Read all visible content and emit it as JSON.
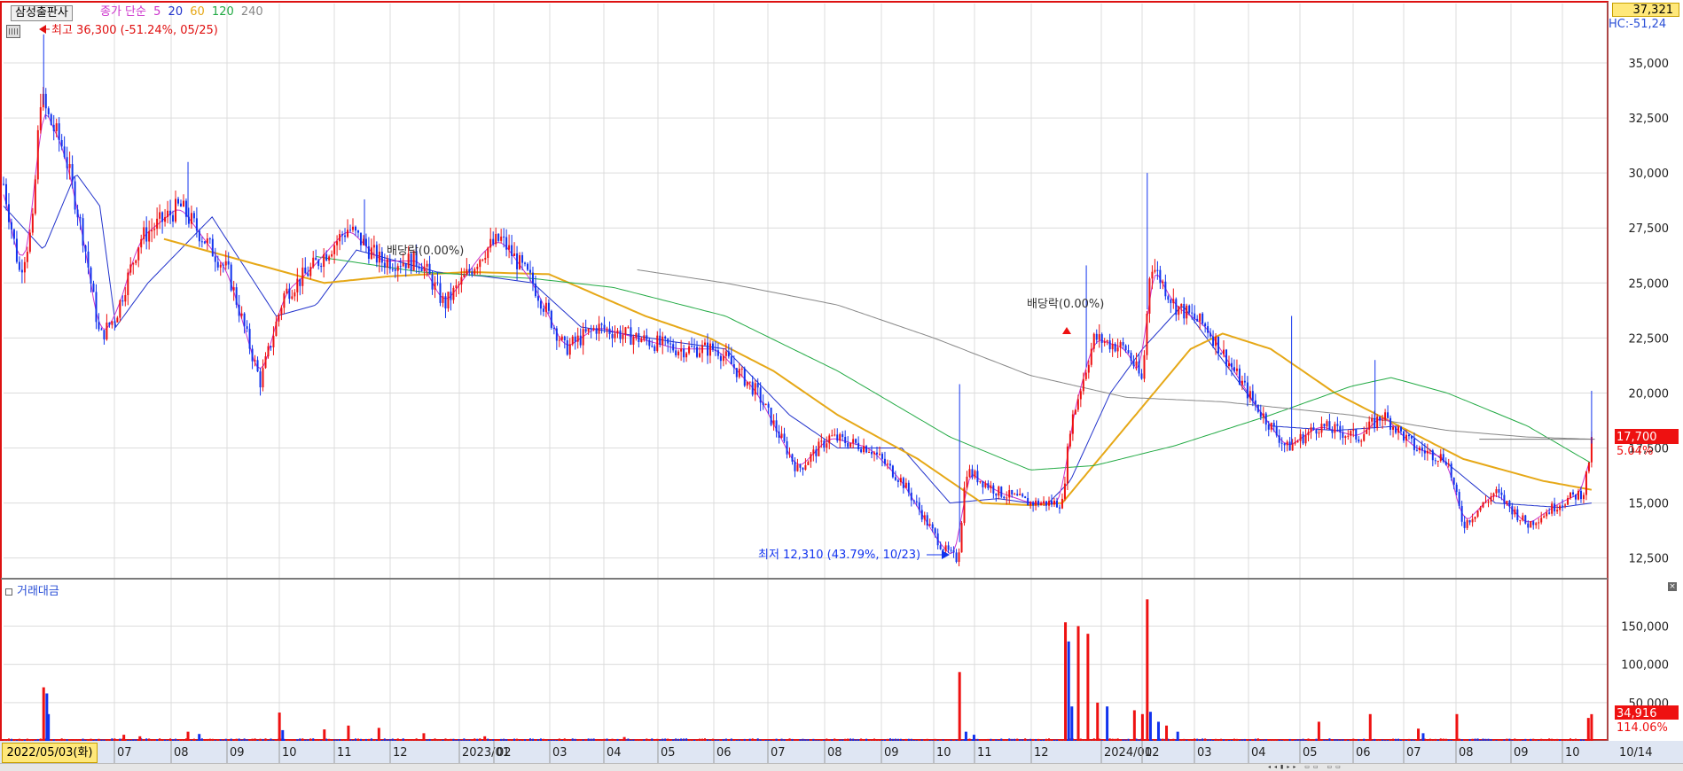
{
  "header": {
    "stock_name": "삼성출판사",
    "ma_prefix": "종가 단순",
    "ma_periods": [
      {
        "label": "5",
        "color": "#cc33cc"
      },
      {
        "label": "20",
        "color": "#2233cc"
      },
      {
        "label": "60",
        "color": "#e6a817"
      },
      {
        "label": "120",
        "color": "#22aa44"
      },
      {
        "label": "240",
        "color": "#888888"
      }
    ],
    "current_box": "37,321",
    "hc_label": "HC:-51,24"
  },
  "annotations": {
    "high": "최고 36,300 (-51.24%, 05/25)",
    "low": "최저 12,310 (43.79%, 10/23)",
    "dividend1": "배당락(0.00%)",
    "dividend2": "배당락(0.00%)"
  },
  "price_labels": {
    "last_price": "17,700",
    "last_change": "5.04%",
    "last_volume": "34,916",
    "volume_pct": "114.06%"
  },
  "volume_panel": {
    "title": "거래대금",
    "close": "×"
  },
  "x_axis": {
    "start_date": "2022/05/03(화)",
    "end_label": "10/14",
    "ticks": [
      "07",
      "08",
      "09",
      "10",
      "11",
      "12",
      "2023/01",
      "02",
      "03",
      "04",
      "05",
      "06",
      "07",
      "08",
      "09",
      "10",
      "11",
      "12",
      "2024/01",
      "02",
      "03",
      "04",
      "05",
      "06",
      "07",
      "08",
      "09",
      "10"
    ]
  },
  "colors": {
    "up": "#ee1111",
    "down": "#1133ee",
    "frame": "#d11",
    "grid": "#dcdcdc"
  },
  "chart_data": {
    "type": "candlestick",
    "y_axis": {
      "ticks": [
        "35,000",
        "32,500",
        "30,000",
        "27,500",
        "25,000",
        "22,500",
        "20,000",
        "17,500",
        "15,000",
        "12,500"
      ],
      "ylim": [
        11600,
        37700
      ]
    },
    "volume_axis": {
      "ticks": [
        "150,000",
        "100,000",
        "50,000"
      ],
      "ylim": [
        0,
        190000
      ]
    },
    "price_anchors": [
      {
        "t": 0.0,
        "v": 29500
      },
      {
        "t": 0.01,
        "v": 25500
      },
      {
        "t": 0.018,
        "v": 27500
      },
      {
        "t": 0.023,
        "v": 33500
      },
      {
        "t": 0.028,
        "v": 32500
      },
      {
        "t": 0.038,
        "v": 31000
      },
      {
        "t": 0.05,
        "v": 27000
      },
      {
        "t": 0.06,
        "v": 22500
      },
      {
        "t": 0.07,
        "v": 23500
      },
      {
        "t": 0.085,
        "v": 27000
      },
      {
        "t": 0.11,
        "v": 28500
      },
      {
        "t": 0.125,
        "v": 27000
      },
      {
        "t": 0.14,
        "v": 25500
      },
      {
        "t": 0.16,
        "v": 20500
      },
      {
        "t": 0.175,
        "v": 24500
      },
      {
        "t": 0.19,
        "v": 25500
      },
      {
        "t": 0.215,
        "v": 27500
      },
      {
        "t": 0.235,
        "v": 26000
      },
      {
        "t": 0.26,
        "v": 26000
      },
      {
        "t": 0.275,
        "v": 24000
      },
      {
        "t": 0.3,
        "v": 26500
      },
      {
        "t": 0.31,
        "v": 27000
      },
      {
        "t": 0.33,
        "v": 25000
      },
      {
        "t": 0.35,
        "v": 22000
      },
      {
        "t": 0.37,
        "v": 23000
      },
      {
        "t": 0.395,
        "v": 22500
      },
      {
        "t": 0.42,
        "v": 22000
      },
      {
        "t": 0.445,
        "v": 22000
      },
      {
        "t": 0.47,
        "v": 20000
      },
      {
        "t": 0.495,
        "v": 16500
      },
      {
        "t": 0.515,
        "v": 18000
      },
      {
        "t": 0.54,
        "v": 17500
      },
      {
        "t": 0.56,
        "v": 16000
      },
      {
        "t": 0.585,
        "v": 13000
      },
      {
        "t": 0.595,
        "v": 12400
      },
      {
        "t": 0.6,
        "v": 16500
      },
      {
        "t": 0.62,
        "v": 15500
      },
      {
        "t": 0.64,
        "v": 15000
      },
      {
        "t": 0.66,
        "v": 15000
      },
      {
        "t": 0.665,
        "v": 18500
      },
      {
        "t": 0.68,
        "v": 22500
      },
      {
        "t": 0.7,
        "v": 22000
      },
      {
        "t": 0.71,
        "v": 20500
      },
      {
        "t": 0.715,
        "v": 26000
      },
      {
        "t": 0.73,
        "v": 24000
      },
      {
        "t": 0.75,
        "v": 23000
      },
      {
        "t": 0.78,
        "v": 19500
      },
      {
        "t": 0.8,
        "v": 17500
      },
      {
        "t": 0.82,
        "v": 18500
      },
      {
        "t": 0.845,
        "v": 18000
      },
      {
        "t": 0.86,
        "v": 19000
      },
      {
        "t": 0.88,
        "v": 17500
      },
      {
        "t": 0.9,
        "v": 17000
      },
      {
        "t": 0.91,
        "v": 14000
      },
      {
        "t": 0.93,
        "v": 15500
      },
      {
        "t": 0.95,
        "v": 14000
      },
      {
        "t": 0.97,
        "v": 15000
      },
      {
        "t": 0.985,
        "v": 15500
      },
      {
        "t": 0.99,
        "v": 17700
      }
    ],
    "ma_anchors": {
      "ma20": [
        {
          "t": 0.0,
          "v": 28500
        },
        {
          "t": 0.025,
          "v": 26500
        },
        {
          "t": 0.045,
          "v": 30000
        },
        {
          "t": 0.06,
          "v": 28500
        },
        {
          "t": 0.07,
          "v": 23000
        },
        {
          "t": 0.09,
          "v": 25000
        },
        {
          "t": 0.13,
          "v": 28000
        },
        {
          "t": 0.17,
          "v": 23500
        },
        {
          "t": 0.195,
          "v": 24000
        },
        {
          "t": 0.22,
          "v": 26500
        },
        {
          "t": 0.27,
          "v": 25500
        },
        {
          "t": 0.3,
          "v": 25300
        },
        {
          "t": 0.33,
          "v": 25000
        },
        {
          "t": 0.36,
          "v": 23000
        },
        {
          "t": 0.42,
          "v": 22300
        },
        {
          "t": 0.45,
          "v": 22000
        },
        {
          "t": 0.49,
          "v": 19000
        },
        {
          "t": 0.52,
          "v": 17500
        },
        {
          "t": 0.56,
          "v": 17500
        },
        {
          "t": 0.59,
          "v": 15000
        },
        {
          "t": 0.62,
          "v": 15200
        },
        {
          "t": 0.65,
          "v": 14900
        },
        {
          "t": 0.665,
          "v": 16000
        },
        {
          "t": 0.69,
          "v": 20000
        },
        {
          "t": 0.71,
          "v": 22000
        },
        {
          "t": 0.735,
          "v": 24000
        },
        {
          "t": 0.76,
          "v": 21500
        },
        {
          "t": 0.79,
          "v": 18500
        },
        {
          "t": 0.83,
          "v": 18300
        },
        {
          "t": 0.87,
          "v": 18500
        },
        {
          "t": 0.9,
          "v": 16800
        },
        {
          "t": 0.93,
          "v": 15000
        },
        {
          "t": 0.97,
          "v": 14800
        },
        {
          "t": 0.99,
          "v": 15000
        }
      ],
      "ma60": [
        {
          "t": 0.1,
          "v": 27000
        },
        {
          "t": 0.15,
          "v": 26000
        },
        {
          "t": 0.2,
          "v": 25000
        },
        {
          "t": 0.24,
          "v": 25300
        },
        {
          "t": 0.29,
          "v": 25500
        },
        {
          "t": 0.34,
          "v": 25400
        },
        {
          "t": 0.4,
          "v": 23500
        },
        {
          "t": 0.44,
          "v": 22500
        },
        {
          "t": 0.48,
          "v": 21000
        },
        {
          "t": 0.52,
          "v": 19000
        },
        {
          "t": 0.57,
          "v": 17000
        },
        {
          "t": 0.61,
          "v": 15000
        },
        {
          "t": 0.64,
          "v": 14900
        },
        {
          "t": 0.66,
          "v": 15000
        },
        {
          "t": 0.7,
          "v": 18500
        },
        {
          "t": 0.74,
          "v": 22000
        },
        {
          "t": 0.76,
          "v": 22700
        },
        {
          "t": 0.79,
          "v": 22000
        },
        {
          "t": 0.83,
          "v": 20000
        },
        {
          "t": 0.87,
          "v": 18500
        },
        {
          "t": 0.91,
          "v": 17000
        },
        {
          "t": 0.96,
          "v": 16000
        },
        {
          "t": 0.99,
          "v": 15600
        }
      ],
      "ma120": [
        {
          "t": 0.195,
          "v": 26200
        },
        {
          "t": 0.26,
          "v": 25500
        },
        {
          "t": 0.33,
          "v": 25200
        },
        {
          "t": 0.38,
          "v": 24800
        },
        {
          "t": 0.45,
          "v": 23500
        },
        {
          "t": 0.52,
          "v": 21000
        },
        {
          "t": 0.59,
          "v": 18000
        },
        {
          "t": 0.64,
          "v": 16500
        },
        {
          "t": 0.68,
          "v": 16700
        },
        {
          "t": 0.73,
          "v": 17600
        },
        {
          "t": 0.79,
          "v": 19000
        },
        {
          "t": 0.84,
          "v": 20300
        },
        {
          "t": 0.865,
          "v": 20700
        },
        {
          "t": 0.9,
          "v": 20000
        },
        {
          "t": 0.95,
          "v": 18500
        },
        {
          "t": 0.99,
          "v": 16800
        }
      ],
      "ma240": [
        {
          "t": 0.395,
          "v": 25600
        },
        {
          "t": 0.45,
          "v": 25000
        },
        {
          "t": 0.52,
          "v": 24000
        },
        {
          "t": 0.58,
          "v": 22500
        },
        {
          "t": 0.64,
          "v": 20800
        },
        {
          "t": 0.7,
          "v": 19800
        },
        {
          "t": 0.76,
          "v": 19600
        },
        {
          "t": 0.84,
          "v": 19000
        },
        {
          "t": 0.9,
          "v": 18300
        },
        {
          "t": 0.95,
          "v": 18000
        },
        {
          "t": 0.99,
          "v": 17900
        }
      ]
    },
    "volume_spikes": [
      {
        "t": 0.025,
        "v": 70000,
        "up": true
      },
      {
        "t": 0.027,
        "v": 62000,
        "up": false
      },
      {
        "t": 0.028,
        "v": 35000,
        "up": false
      },
      {
        "t": 0.075,
        "v": 8000,
        "up": true
      },
      {
        "t": 0.085,
        "v": 6000,
        "up": true
      },
      {
        "t": 0.115,
        "v": 12000,
        "up": true
      },
      {
        "t": 0.122,
        "v": 9000,
        "up": false
      },
      {
        "t": 0.172,
        "v": 37000,
        "up": true
      },
      {
        "t": 0.174,
        "v": 14000,
        "up": false
      },
      {
        "t": 0.2,
        "v": 15000,
        "up": true
      },
      {
        "t": 0.215,
        "v": 20000,
        "up": true
      },
      {
        "t": 0.234,
        "v": 17000,
        "up": true
      },
      {
        "t": 0.262,
        "v": 10000,
        "up": true
      },
      {
        "t": 0.3,
        "v": 6000,
        "up": true
      },
      {
        "t": 0.387,
        "v": 5000,
        "up": true
      },
      {
        "t": 0.596,
        "v": 90000,
        "up": true
      },
      {
        "t": 0.6,
        "v": 12000,
        "up": false
      },
      {
        "t": 0.605,
        "v": 8000,
        "up": false
      },
      {
        "t": 0.662,
        "v": 155000,
        "up": true
      },
      {
        "t": 0.664,
        "v": 130000,
        "up": false
      },
      {
        "t": 0.666,
        "v": 45000,
        "up": false
      },
      {
        "t": 0.67,
        "v": 150000,
        "up": true
      },
      {
        "t": 0.676,
        "v": 140000,
        "up": true
      },
      {
        "t": 0.682,
        "v": 50000,
        "up": true
      },
      {
        "t": 0.688,
        "v": 45000,
        "up": false
      },
      {
        "t": 0.705,
        "v": 40000,
        "up": true
      },
      {
        "t": 0.71,
        "v": 35000,
        "up": true
      },
      {
        "t": 0.713,
        "v": 185000,
        "up": true
      },
      {
        "t": 0.715,
        "v": 38000,
        "up": false
      },
      {
        "t": 0.72,
        "v": 25000,
        "up": false
      },
      {
        "t": 0.725,
        "v": 20000,
        "up": true
      },
      {
        "t": 0.732,
        "v": 12000,
        "up": false
      },
      {
        "t": 0.82,
        "v": 25000,
        "up": true
      },
      {
        "t": 0.852,
        "v": 35000,
        "up": true
      },
      {
        "t": 0.882,
        "v": 16000,
        "up": true
      },
      {
        "t": 0.885,
        "v": 10000,
        "up": false
      },
      {
        "t": 0.906,
        "v": 35000,
        "up": true
      },
      {
        "t": 0.988,
        "v": 30000,
        "up": true
      },
      {
        "t": 0.99,
        "v": 34916,
        "up": true
      }
    ]
  }
}
